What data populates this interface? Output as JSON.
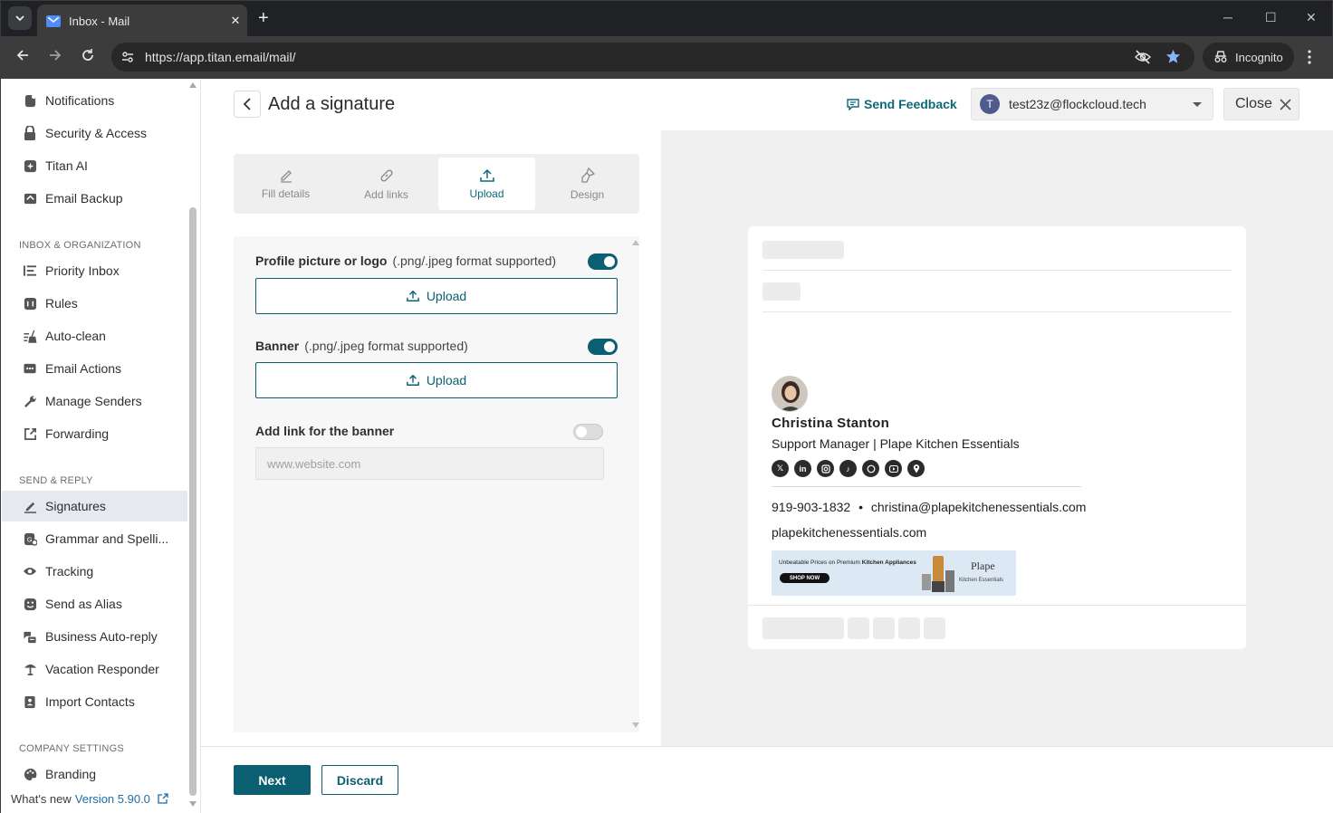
{
  "browser": {
    "tab_title": "Inbox - Mail",
    "url": "https://app.titan.email/mail/",
    "incognito_label": "Incognito"
  },
  "sidebar": {
    "items_top": [
      {
        "label": "Notifications",
        "icon": "bell-icon"
      },
      {
        "label": "Security & Access",
        "icon": "lock-icon"
      },
      {
        "label": "Titan AI",
        "icon": "sparkle-icon"
      },
      {
        "label": "Email Backup",
        "icon": "backup-icon"
      }
    ],
    "section_inbox": "INBOX & ORGANIZATION",
    "items_inbox": [
      {
        "label": "Priority Inbox",
        "icon": "priority-icon"
      },
      {
        "label": "Rules",
        "icon": "rules-icon"
      },
      {
        "label": "Auto-clean",
        "icon": "broom-icon"
      },
      {
        "label": "Email Actions",
        "icon": "actions-icon"
      },
      {
        "label": "Manage Senders",
        "icon": "wrench-icon"
      },
      {
        "label": "Forwarding",
        "icon": "forward-icon"
      }
    ],
    "section_send": "SEND & REPLY",
    "items_send": [
      {
        "label": "Signatures",
        "icon": "pen-icon",
        "active": true
      },
      {
        "label": "Grammar and Spelli...",
        "icon": "grammar-icon"
      },
      {
        "label": "Tracking",
        "icon": "eye-icon"
      },
      {
        "label": "Send as Alias",
        "icon": "alias-icon"
      },
      {
        "label": "Business Auto-reply",
        "icon": "autoreply-icon"
      },
      {
        "label": "Vacation Responder",
        "icon": "umbrella-icon"
      },
      {
        "label": "Import Contacts",
        "icon": "contacts-icon"
      }
    ],
    "section_company": "COMPANY SETTINGS",
    "items_company": [
      {
        "label": "Branding",
        "icon": "palette-icon"
      }
    ],
    "footer_text": "What's new",
    "footer_version": "Version 5.90.0"
  },
  "header": {
    "title": "Add a signature",
    "feedback": "Send Feedback",
    "account_initial": "T",
    "account_email": "test23z@flockcloud.tech",
    "close_label": "Close"
  },
  "steps": [
    {
      "label": "Fill details",
      "icon": "pencil-icon"
    },
    {
      "label": "Add links",
      "icon": "link-icon"
    },
    {
      "label": "Upload",
      "icon": "upload-icon",
      "active": true
    },
    {
      "label": "Design",
      "icon": "brush-icon"
    }
  ],
  "form": {
    "profile_label": "Profile picture or logo",
    "profile_hint": "(.png/.jpeg format supported)",
    "profile_toggle": true,
    "banner_label": "Banner",
    "banner_hint": "(.png/.jpeg format supported)",
    "banner_toggle": true,
    "upload_label": "Upload",
    "link_label": "Add link for the banner",
    "link_toggle": false,
    "link_placeholder": "www.website.com"
  },
  "preview": {
    "name": "Christina Stanton",
    "role": "Support Manager | Plape Kitchen Essentials",
    "socials": [
      "x-icon",
      "linkedin-icon",
      "instagram-icon",
      "tiktok-icon",
      "whatsapp-icon",
      "youtube-icon",
      "location-icon"
    ],
    "phone": "919-903-1832",
    "email": "christina@plapekitchenessentials.com",
    "website": "plapekitchenessentials.com",
    "banner_text_prefix": "Unbeatable Prices on Premium ",
    "banner_text_bold": "Kitchen Appliances",
    "banner_cta": "SHOP NOW",
    "banner_brand": "Plape",
    "banner_brand_sub": "Kitchen Essentials"
  },
  "footer": {
    "next_label": "Next",
    "discard_label": "Discard"
  },
  "colors": {
    "accent": "#0b5f70",
    "link": "#1b6ea6",
    "active_nav": "#e6e9ee"
  }
}
